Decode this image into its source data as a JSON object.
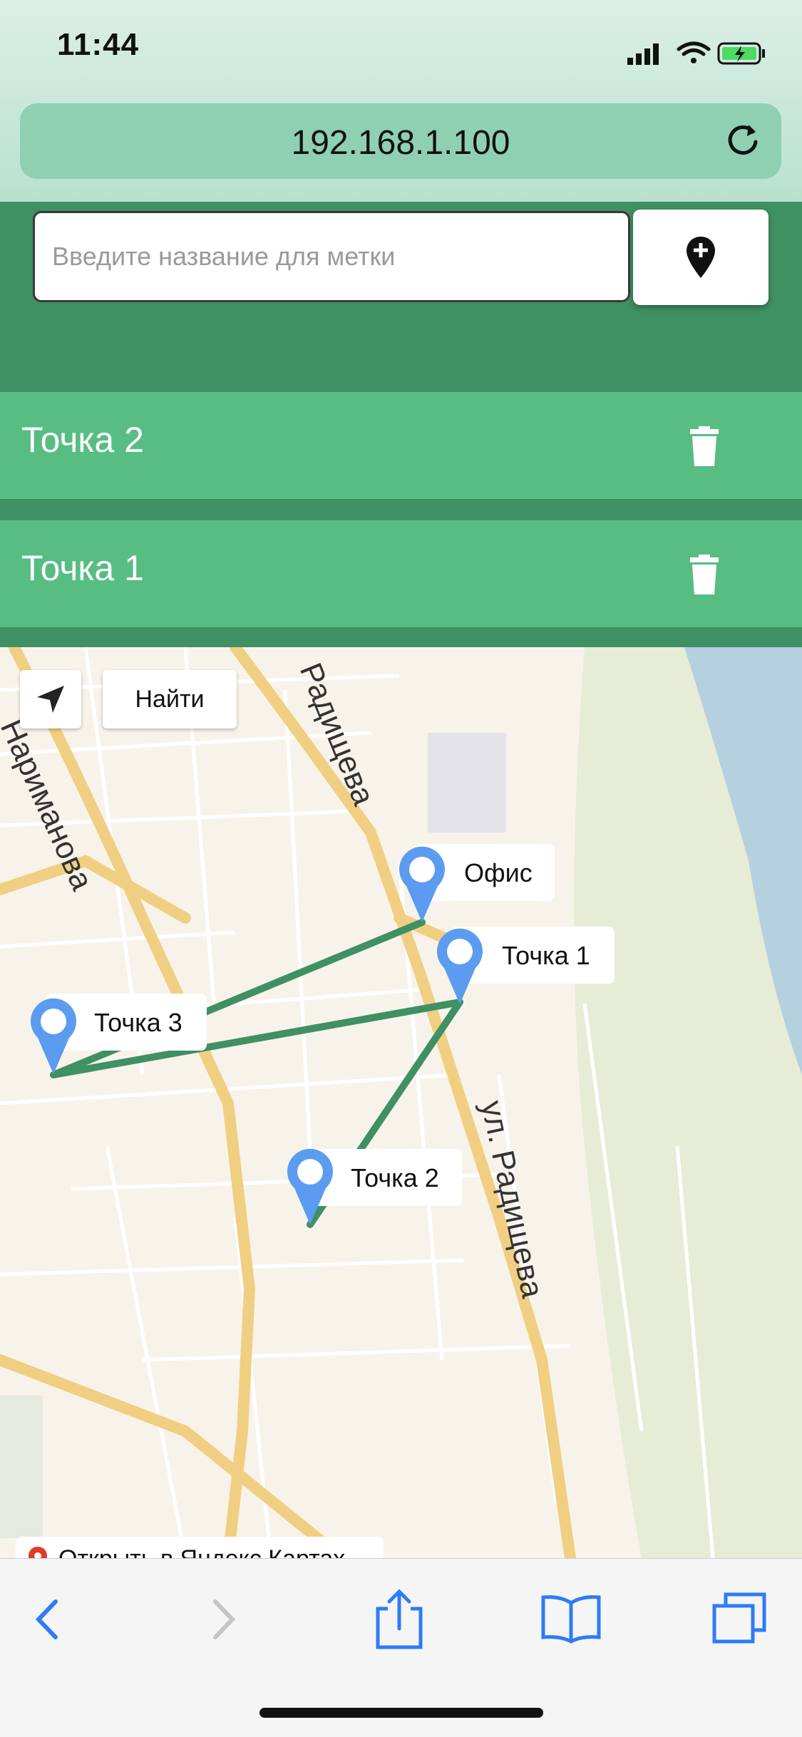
{
  "status_bar": {
    "time": "11:44",
    "icons": [
      "signal-icon",
      "wifi-icon",
      "battery-charging-icon"
    ]
  },
  "browser": {
    "url": "192.168.1.100",
    "reload_icon": "reload-icon"
  },
  "form": {
    "placeholder": "Введите название для метки",
    "value": "",
    "add_icon": "map-marker-plus-icon"
  },
  "points": [
    {
      "label": "Точка 2",
      "delete_icon": "trash-icon"
    },
    {
      "label": "Точка 1",
      "delete_icon": "trash-icon"
    }
  ],
  "map": {
    "find_label": "Найти",
    "locate_icon": "navigation-arrow-icon",
    "streets": [
      "Радищева",
      "Нариманова",
      "ул. Радищева"
    ],
    "placemarks": [
      "Офис",
      "Точка 1",
      "Точка 3",
      "Точка 2"
    ],
    "route_color": "#3f9063",
    "open_in_yandex": "Открыть в Яндекс.Картах"
  },
  "toolbar": [
    "back-icon",
    "forward-icon",
    "share-icon",
    "bookmarks-icon",
    "tabs-icon"
  ]
}
